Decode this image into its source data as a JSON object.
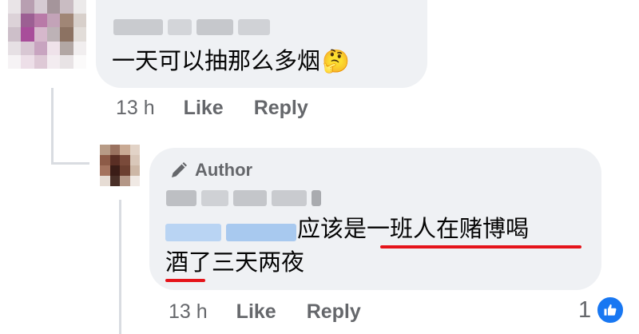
{
  "comments": {
    "top": {
      "text": "一天可以抽那么多烟",
      "emoji": "🤔",
      "time": "13 h",
      "like_label": "Like",
      "reply_label": "Reply"
    },
    "reply": {
      "badge_label": "Author",
      "line1_text": "应该是一班人在赌博喝",
      "line2_text": "酒了三天两夜",
      "time": "13 h",
      "like_label": "Like",
      "reply_label": "Reply",
      "reaction_count": "1"
    }
  },
  "colors": {
    "bubble": "#eff1f4",
    "muted_text": "#65676b",
    "like_blue": "#1877f2",
    "annotation_red": "#e5141a",
    "mention_blur": "#b9d4f3"
  },
  "icons": {
    "author_badge": "pencil-icon",
    "reaction": "thumbs-up-icon",
    "emoji": "thinking-face"
  }
}
